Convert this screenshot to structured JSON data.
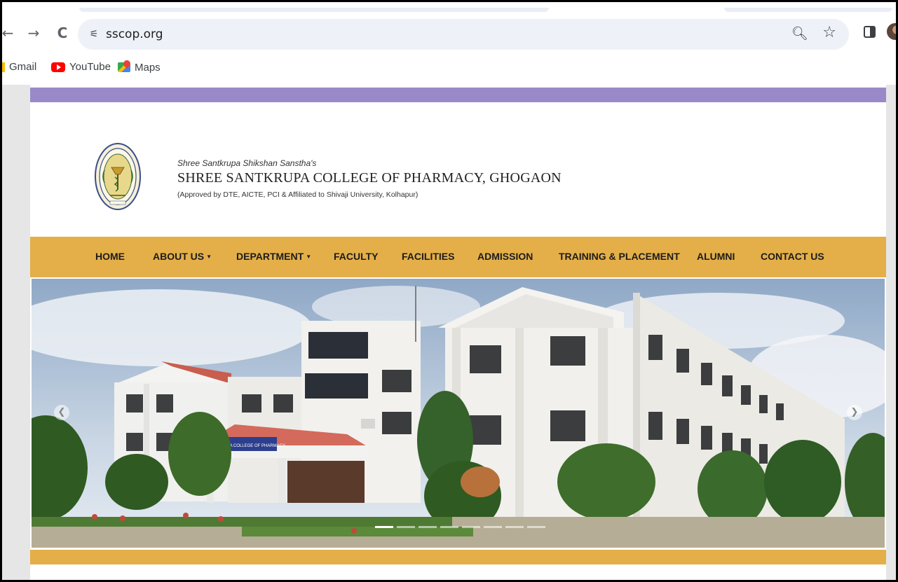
{
  "browser": {
    "url": "sscop.org",
    "back_glyph": "←",
    "forward_glyph": "→",
    "reload_glyph": "C",
    "zoom_icon": "zoom-icon",
    "bookmark_icon": "star-icon",
    "bookmarks": [
      {
        "label": "Gmail",
        "icon": "gmail-icon"
      },
      {
        "label": "YouTube",
        "icon": "youtube-icon"
      },
      {
        "label": "Maps",
        "icon": "maps-icon"
      }
    ]
  },
  "site": {
    "tagline": "Shree Santkrupa Shikshan Sanstha's",
    "college_name": "SHREE SANTKRUPA COLLEGE OF PHARMACY, GHOGAON",
    "approval": "(Approved by DTE, AICTE, PCI & Affiliated to Shivaji University, Kolhapur)",
    "seal_text": "SHREE SANTKRUPA COLLEGE OF PHARMACY",
    "seal_estd": "ESTD-2004",
    "nav": [
      {
        "label": "HOME",
        "has_dropdown": false
      },
      {
        "label": "ABOUT US",
        "has_dropdown": true
      },
      {
        "label": "DEPARTMENT",
        "has_dropdown": true
      },
      {
        "label": "FACULTY",
        "has_dropdown": false
      },
      {
        "label": "FACILITIES",
        "has_dropdown": false
      },
      {
        "label": "ADMISSION",
        "has_dropdown": false
      },
      {
        "label": "TRAINING & PLACEMENT",
        "has_dropdown": false
      },
      {
        "label": "ALUMNI",
        "has_dropdown": false
      },
      {
        "label": "CONTACT US",
        "has_dropdown": false
      }
    ],
    "slider": {
      "banner_text": "SHREE SANTKRUPA COLLEGE OF PHARMACY",
      "slide_count": 8,
      "active_slide": 1
    },
    "colors": {
      "top_stripe": "#9a89c9",
      "nav_bar": "#e4af48"
    }
  }
}
